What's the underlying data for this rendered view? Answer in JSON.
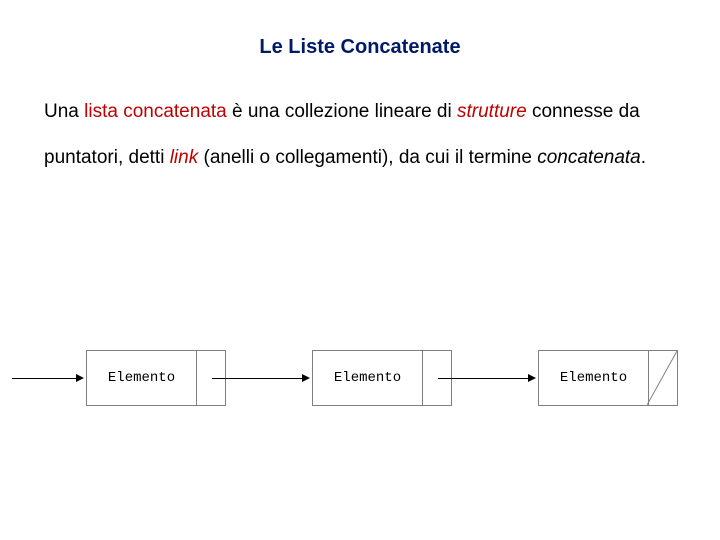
{
  "title": "Le Liste Concatenate",
  "para": {
    "t1": "Una ",
    "t2": "lista concatenata",
    "t3": " è una collezione lineare di ",
    "t4": "strutture",
    "t5": " connesse da puntatori, detti ",
    "t6": "link",
    "t7": " (anelli o collegamenti), da cui il termine ",
    "t8": "concatenata",
    "t9": "."
  },
  "diagram": {
    "node_label": "Elemento"
  }
}
